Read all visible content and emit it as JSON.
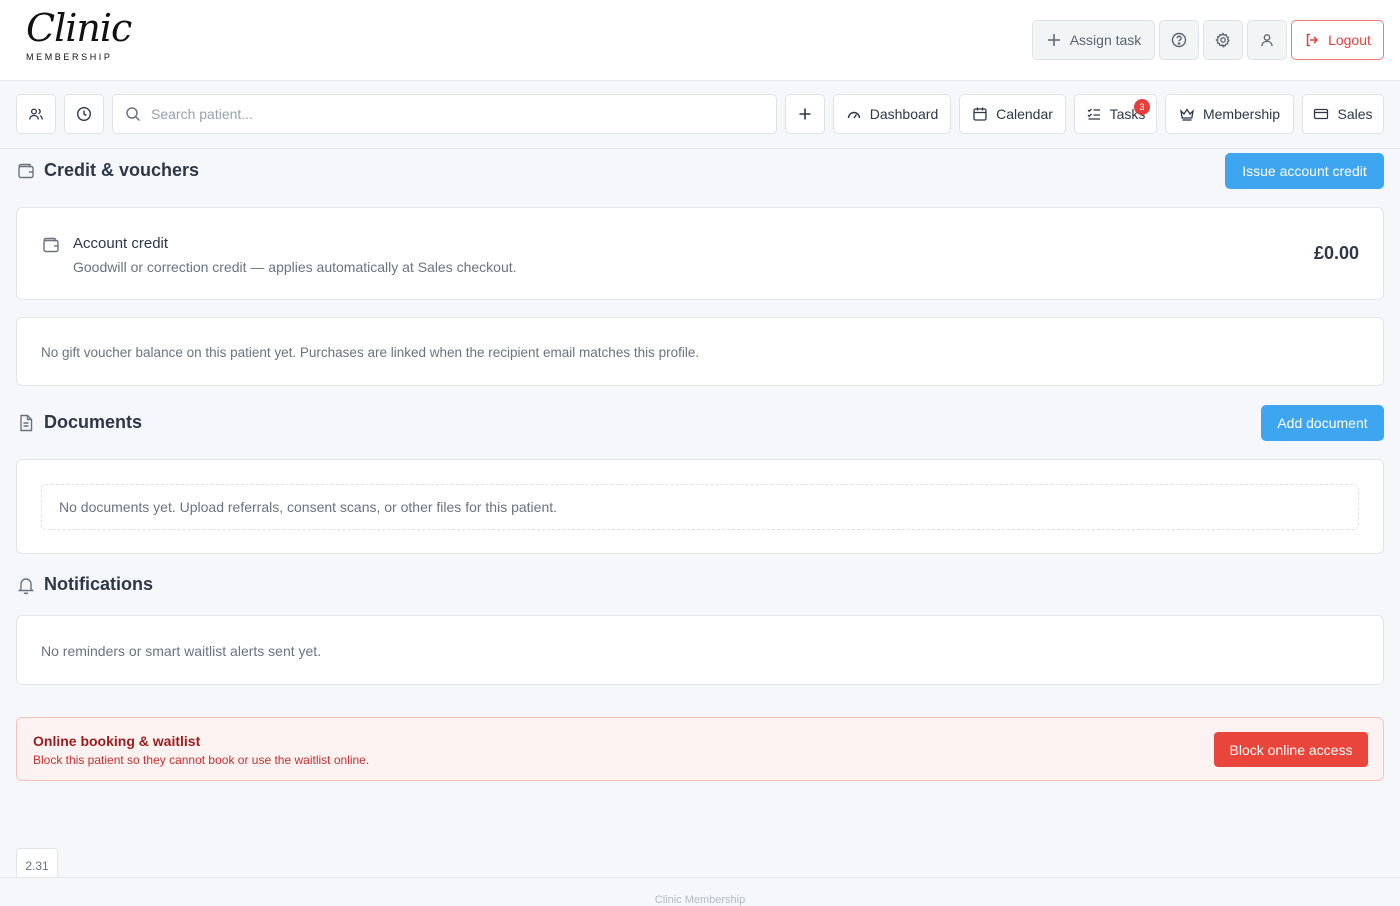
{
  "brand": {
    "script": "Clinic",
    "sub": "MEMBERSHIP"
  },
  "header": {
    "assign_task": "Assign task",
    "logout": "Logout"
  },
  "toolbar": {
    "search_placeholder": "Search patient...",
    "dashboard": "Dashboard",
    "calendar": "Calendar",
    "tasks": "Tasks",
    "tasks_badge": "3",
    "membership": "Membership",
    "sales": "Sales"
  },
  "credit": {
    "title": "Credit & vouchers",
    "issue_button": "Issue account credit",
    "account_title": "Account credit",
    "account_desc": "Goodwill or correction credit — applies automatically at Sales checkout.",
    "amount": "£0.00",
    "voucher_note": "No gift voucher balance on this patient yet. Purchases are linked when the recipient email matches this profile."
  },
  "documents": {
    "title": "Documents",
    "add_button": "Add document",
    "empty": "No documents yet. Upload referrals, consent scans, or other files for this patient."
  },
  "notifications": {
    "title": "Notifications",
    "empty": "No reminders or smart waitlist alerts sent yet."
  },
  "online_booking": {
    "title": "Online booking & waitlist",
    "desc": "Block this patient so they cannot book or use the waitlist online.",
    "button": "Block online access"
  },
  "version": "2.31",
  "footer": "Clinic Membership",
  "colors": {
    "primary": "#3ea6f0",
    "danger": "#e9453a",
    "danger_bg": "#fdf2f2"
  }
}
